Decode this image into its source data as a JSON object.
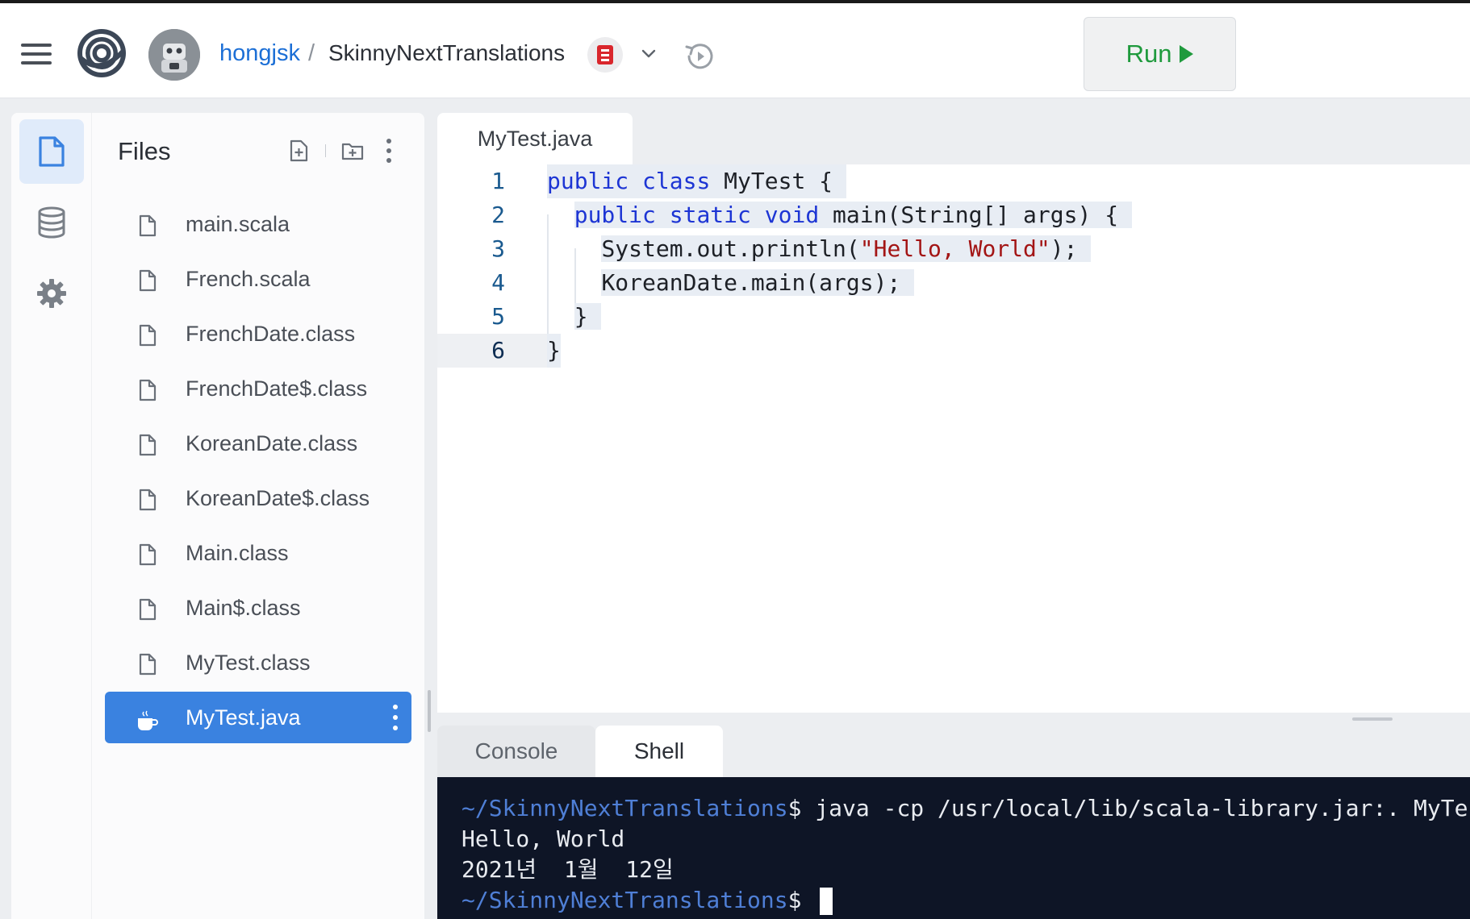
{
  "header": {
    "user": "hongjsk",
    "separator": "/",
    "repl_name": "SkinnyNextTranslations",
    "run_label": "Run"
  },
  "files_panel": {
    "title": "Files",
    "files": [
      {
        "name": "main.scala"
      },
      {
        "name": "French.scala"
      },
      {
        "name": "FrenchDate.class"
      },
      {
        "name": "FrenchDate$.class"
      },
      {
        "name": "KoreanDate.class"
      },
      {
        "name": "KoreanDate$.class"
      },
      {
        "name": "Main.class"
      },
      {
        "name": "Main$.class"
      },
      {
        "name": "MyTest.class"
      },
      {
        "name": "MyTest.java"
      }
    ]
  },
  "editor": {
    "tab_label": "MyTest.java",
    "lines": [
      {
        "no": "1",
        "text": "public class MyTest {"
      },
      {
        "no": "2",
        "text": "  public static void main(String[] args) {"
      },
      {
        "no": "3",
        "text": "    System.out.println(\"Hello, World\");"
      },
      {
        "no": "4",
        "text": "    KoreanDate.main(args);"
      },
      {
        "no": "5",
        "text": "  }"
      },
      {
        "no": "6",
        "text": "}"
      }
    ]
  },
  "bottom_tabs": {
    "console": "Console",
    "shell": "Shell"
  },
  "terminal": {
    "prompt1": "~/SkinnyNextTranslations",
    "cmd1": "$ java -cp /usr/local/lib/scala-library.jar:. MyTest",
    "out1": "Hello, World",
    "out2": "2021년  1월  12일",
    "prompt2": "~/SkinnyNextTranslations",
    "cmd2": "$ "
  },
  "colors": {
    "accent": "#3a82e0",
    "run_green": "#1f9a3d",
    "keyword": "#1d35d4",
    "string": "#a31515",
    "terminal_bg": "#0e1526"
  },
  "icons": [
    "menu-icon",
    "replit-logo-icon",
    "user-avatar-icon",
    "language-icon",
    "chevron-down-icon",
    "history-icon",
    "play-icon",
    "file-icon",
    "database-icon",
    "gear-icon",
    "new-file-icon",
    "new-folder-icon",
    "more-vertical-icon",
    "java-coffee-icon"
  ]
}
